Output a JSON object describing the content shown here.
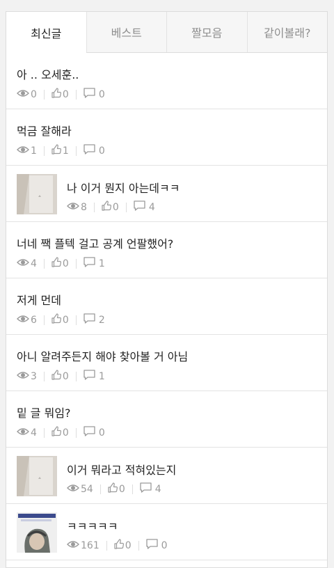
{
  "tabs": [
    {
      "label": "최신글",
      "active": true
    },
    {
      "label": "베스트",
      "active": false
    },
    {
      "label": "짤모음",
      "active": false
    },
    {
      "label": "같이볼래?",
      "active": false
    }
  ],
  "posts": [
    {
      "title": "아 .. 오세훈..",
      "views": "0",
      "likes": "0",
      "comments": "0",
      "thumb": null
    },
    {
      "title": "먹금 잘해라",
      "views": "1",
      "likes": "1",
      "comments": "0",
      "thumb": null
    },
    {
      "title": "나 이거 뭔지 아는데ㅋㅋ",
      "views": "8",
      "likes": "0",
      "comments": "4",
      "thumb": "paper"
    },
    {
      "title": "너네 짹 플텍 걸고 공계 언팔했어?",
      "views": "4",
      "likes": "0",
      "comments": "1",
      "thumb": null
    },
    {
      "title": "저게 먼데",
      "views": "6",
      "likes": "0",
      "comments": "2",
      "thumb": null
    },
    {
      "title": "아니 알려주든지 해야 찾아볼 거 아님",
      "views": "3",
      "likes": "0",
      "comments": "1",
      "thumb": null
    },
    {
      "title": "밑 글 뭐임?",
      "views": "4",
      "likes": "0",
      "comments": "0",
      "thumb": null
    },
    {
      "title": "이거 뭐라고 적혀있는지",
      "views": "54",
      "likes": "0",
      "comments": "4",
      "thumb": "paper"
    },
    {
      "title": "ㅋㅋㅋㅋㅋ",
      "views": "161",
      "likes": "0",
      "comments": "0",
      "thumb": "cartoon"
    }
  ],
  "icons": {
    "views": "eye-icon",
    "likes": "thumbs-up-icon",
    "comments": "comment-icon"
  },
  "colors": {
    "meta": "#9a9a9a",
    "border": "#dcdcdc",
    "tab_inactive_bg": "#f6f6f6"
  }
}
